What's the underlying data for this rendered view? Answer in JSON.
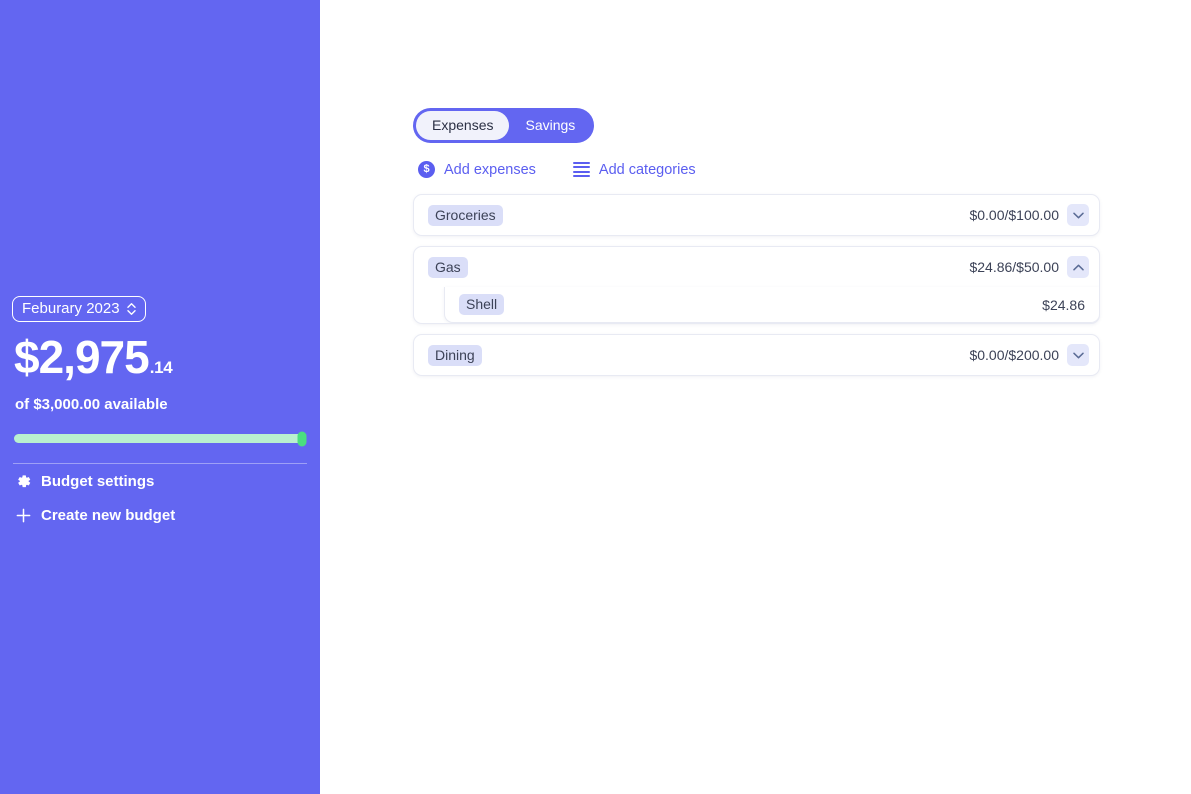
{
  "sidebar": {
    "month_selector": {
      "label": "Feburary 2023",
      "icon": "chevron-updown-icon"
    },
    "balance": {
      "amount_main": "$2,975",
      "amount_cents": ".14",
      "subtitle": "of $3,000.00 available"
    },
    "progress": {
      "percent": 99.2,
      "track_color": "#b9f0cf",
      "thumb_color": "#4ade80"
    },
    "links": [
      {
        "label": "Budget settings",
        "icon": "gear-icon"
      },
      {
        "label": "Create new budget",
        "icon": "plus-icon"
      }
    ],
    "background_color": "#6366f1"
  },
  "main": {
    "tabs": [
      {
        "label": "Expenses",
        "active": true
      },
      {
        "label": "Savings",
        "active": false
      }
    ],
    "actions": [
      {
        "label": "Add expenses",
        "icon": "dollar-circle-icon"
      },
      {
        "label": "Add categories",
        "icon": "stack-lines-icon"
      }
    ],
    "categories": [
      {
        "name": "Groceries",
        "amount": "$0.00/$100.00",
        "expanded": false,
        "chevron": "chevron-down-icon",
        "items": []
      },
      {
        "name": "Gas",
        "amount": "$24.86/$50.00",
        "expanded": true,
        "chevron": "chevron-up-icon",
        "items": [
          {
            "name": "Shell",
            "amount": "$24.86"
          }
        ]
      },
      {
        "name": "Dining",
        "amount": "$0.00/$200.00",
        "expanded": false,
        "chevron": "chevron-down-icon",
        "items": []
      }
    ],
    "accent_color": "#5b5ef0",
    "badge_color": "#dadef8"
  }
}
